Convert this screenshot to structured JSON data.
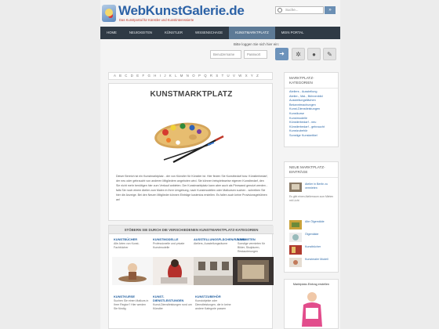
{
  "header": {
    "logo_text": "WebKunstGalerie.de",
    "logo_tagline": "Das Kunstportal für Künstler und Kunstinteressierte",
    "search_placeholder": "Suche...",
    "search_button": "»"
  },
  "nav": {
    "items": [
      {
        "label": "HOME",
        "active": false
      },
      {
        "label": "NEUIGKEITEN",
        "active": false
      },
      {
        "label": "KÜNSTLER",
        "active": false
      },
      {
        "label": "WISSENSCHAGE",
        "active": false
      },
      {
        "label": "KUNSTMARKTPLATZ",
        "active": true
      },
      {
        "label": "MEIN PORTAL",
        "active": false
      }
    ]
  },
  "login": {
    "hint": "Bitte loggen Sie sich hier ein:",
    "user_placeholder": "Benutzername",
    "password_placeholder": "Passwort",
    "icons": [
      "login-icon",
      "help-icon",
      "user-icon",
      "edit-icon"
    ]
  },
  "alphabet": "A B C D E F G H I J K L M N O P Q R S T U V W X Y Z",
  "article": {
    "title": "KUNSTMARKTPLATZ",
    "text": "Dieser Bereich ist ein Kunstmarktplatz - der von Künstler für Künstler ist. Hier finden Sie Kunstbedarf bzw. Künstlerbedarf, der neu oder gebraucht von anderen Mitgliedern angeboten wird. Sie können beispielsweise eigenen Kunstbedarf, den Sie nicht mehr benötigen hier zum Verkauf anbieten. Der Kunstmarktplatz kann aber auch als Pinnwand genutzt werden - falls Sie noch einem Atelier zum Malen in Ihrer Umgebung, nach Kunstmodellen oder Malkursen suchen - schreiben Sie hier die Anzeige. Bei den Neuen Mitglieder können Einträge kostenlos erstellen. Es fallen auch keine Provisionsgebühren an!"
  },
  "categories_section": {
    "heading": "STÖBERN SIE DURCH DIE VERSCHIEDENEN KUNSTMARKTPLATZ-KATEGORIEN",
    "row1": [
      {
        "title": "KUNSTBÜCHER",
        "count": "(1)",
        "desc": "Alle Arten von Kunst-Fachbücher"
      },
      {
        "title": "KUNSTMODELLE",
        "count": "(1)",
        "desc": "Professionelle und private Kunstmodelle"
      },
      {
        "title": "AUSSTELLUNGSFLÄCHEN/RÄUME",
        "count": "(1)",
        "desc": "Ateliers, Ausstellungsräume"
      },
      {
        "title": "BEKANNTMACHUNGEN",
        "count": "(1)",
        "desc": "Sonstige Hinweise & Bekanntmachungen"
      }
    ],
    "row1_extra": {
      "title": "VERMIETEN",
      "desc": "Sonstige vermieten für Bilder, Skulpturen, Restaurierungen"
    },
    "row2": [
      {
        "title": "KUNSTKURSE",
        "count": "(1)",
        "desc": "Suchen Sie einen Malkurs in Ihrer Region? Hier werden Sie fündig"
      },
      {
        "title": "KUNST-DIENSTLEISTUNGEN",
        "count": "(1)",
        "desc": "Kunst-Dienstleistungen rund um Künstler"
      },
      {
        "title": "KUNSTZUBEHÖR",
        "count": "(1)",
        "desc": "Kunstobjekte oder Dienstleistungen, die in keine andere Kategorie passen"
      }
    ]
  },
  "sidebar": {
    "categories_title": "MARKTPLATZ-KATEGORIEN",
    "categories": [
      "Ateliers - Ausstellung",
      "Atelier-, Mal-, Bühnenbild",
      "Ausstellungsflächen",
      "Bekanntmachungen",
      "Kunst-Dienstleistungen",
      "Kunstkurse",
      "Kunstmodelle",
      "Künstlerbedarf - neu",
      "Künstlerbedarf - gebraucht",
      "Kunstzubehör",
      "Sonstige Kunstartikel"
    ],
    "entries_title": "NEUE MARKTPLATZ-EINTRÄGE",
    "entries": [
      {
        "title": "Atelier in Berlin zu vermieten",
        "desc": "Es gibt einen Atelierraum zum Mieten mit Licht"
      },
      {
        "title": "Alte Ölgemälde",
        "desc": ""
      },
      {
        "title": "Ölgemälde",
        "desc": ""
      },
      {
        "title": "Kunstbücher",
        "desc": ""
      },
      {
        "title": "Kunstmaler Modell",
        "desc": ""
      }
    ],
    "promo_text": "Marktplatz-Eintrag erstellen"
  },
  "colors": {
    "brand_blue": "#2c62a6",
    "nav_dark": "#2f3a45",
    "nav_active": "#5d7a96",
    "link_blue": "#1f5d9e"
  }
}
